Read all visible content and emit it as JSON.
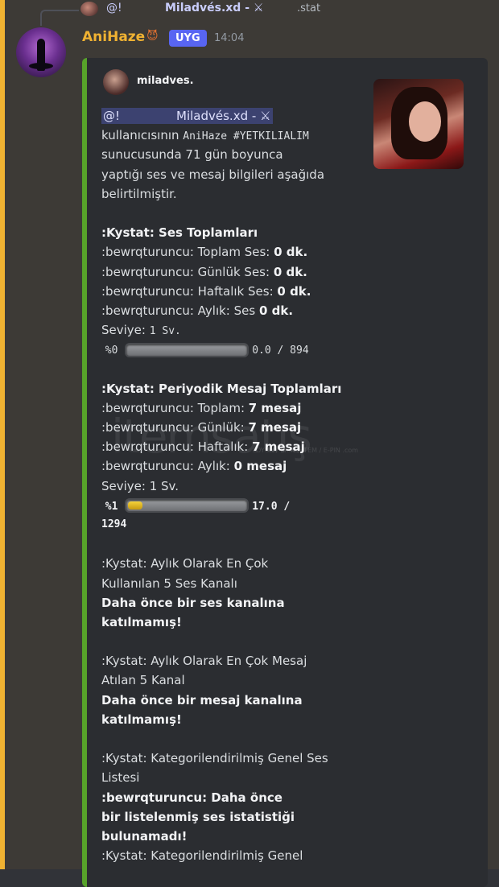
{
  "reply": {
    "mention": "@!",
    "name": "Miladvés.xd - ⚔",
    "text": ".stat"
  },
  "message": {
    "username": "AniHaze",
    "emoji": "😈",
    "tag": "UYG",
    "timestamp": "14:04"
  },
  "embed": {
    "author": "miladves.",
    "mention_prefix": "@!",
    "mention_name": "Miladvés.xd - ⚔",
    "intro_1": "kullanıcısının ",
    "server_code": "AniHaze #YETKILIALIM",
    "intro_2": "sunucusunda 71 gün boyunca",
    "intro_3": "yaptığı ses ve mesaj bilgileri aşağıda",
    "intro_4": "belirtilmiştir.",
    "voice": {
      "title": ":Kystat: Ses Toplamları",
      "prefix": ":bewrqturuncu:",
      "total_label": "Toplam Ses: ",
      "total_value": "0 dk.",
      "daily_label": "Günlük Ses: ",
      "daily_value": "0 dk.",
      "weekly_label": "Haftalık Ses: ",
      "weekly_value": "0 dk.",
      "monthly_label": "Aylık: Ses ",
      "monthly_value": "0 dk.",
      "level_label": "Seviye: ",
      "level_value": "1 Sv.",
      "percent": "%0",
      "progress": 0,
      "progress_text": "0.0 / 894"
    },
    "messages": {
      "title": ":Kystat: Periyodik Mesaj Toplamları",
      "prefix": ":bewrqturuncu:",
      "total_label": "Toplam: ",
      "total_value": "7 mesaj",
      "daily_label": "Günlük: ",
      "daily_value": "7 mesaj",
      "weekly_label": "Haftalık: ",
      "weekly_value": "7 mesaj",
      "monthly_label": "Aylık: ",
      "monthly_value": "0 mesaj",
      "level_text": "Seviye: 1 Sv.",
      "percent": "%1",
      "progress": 0.013,
      "progress_text": "17.0 /",
      "progress_text_2": "1294"
    },
    "top_voice": {
      "title_1": ":Kystat: Aylık Olarak En Çok",
      "title_2": "Kullanılan 5 Ses Kanalı",
      "empty_1": "Daha önce bir ses kanalına",
      "empty_2": "katılmamış!"
    },
    "top_text": {
      "title_1": ":Kystat: Aylık Olarak En Çok Mesaj",
      "title_2": "Atılan 5 Kanal",
      "empty_1": "Daha önce bir mesaj kanalına",
      "empty_2": "katılmamış!"
    },
    "category_voice": {
      "title_1": ":Kystat: Kategorilendirilmiş Genel Ses",
      "title_2": "Listesi",
      "empty_1": ":bewrqturuncu: Daha önce",
      "empty_2": "bir listelenmiş ses istatistiği",
      "empty_3": "bulunamadı!"
    },
    "category_text": {
      "title_1": ":Kystat: Kategorilendirilmiş Genel"
    }
  },
  "watermark": {
    "text": "itemsatış",
    "sub": "OYUN / SKIN / ITEM / E-PIN .com"
  }
}
